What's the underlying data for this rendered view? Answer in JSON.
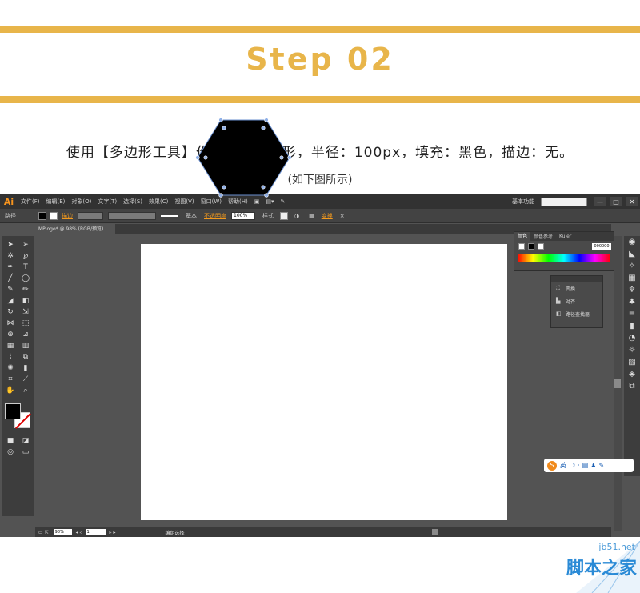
{
  "header": {
    "title": "Step 02"
  },
  "instruction": "使用【多边形工具】作一个正六边形，半径：100px，填充：黑色，描边：无。",
  "caption": "(如下图所示)",
  "illustrator": {
    "logo": "Ai",
    "menu": [
      "文件(F)",
      "编辑(E)",
      "对象(O)",
      "文字(T)",
      "选择(S)",
      "效果(C)",
      "视图(V)",
      "窗口(W)",
      "帮助(H)"
    ],
    "workspace": "基本功能",
    "window_buttons": [
      "—",
      "□",
      "✕"
    ],
    "control": {
      "object_type": "路径",
      "stroke_label": "描边",
      "stroke_profile": "基本",
      "opacity_label": "不透明度",
      "opacity_value": "100%",
      "style_label": "样式",
      "transform_label": "变换"
    },
    "document_tab": "MPlogo* @ 98% (RGB/预览)",
    "color_panel": {
      "tabs": [
        "颜色",
        "颜色参考",
        "Kuler"
      ],
      "hex_value": "000000"
    },
    "transform_panel": {
      "items": [
        {
          "icon": "transform-icon",
          "label": "变换"
        },
        {
          "icon": "align-icon",
          "label": "对齐"
        },
        {
          "icon": "pathfinder-icon",
          "label": "路径查找器"
        }
      ]
    },
    "ime": {
      "label": "英"
    },
    "status": {
      "zoom": "98%",
      "page": "1",
      "tool_text": "编组选择"
    },
    "shape": {
      "type": "hexagon",
      "fill": "#000000",
      "stroke": "none",
      "radius_px": 100
    }
  },
  "watermark": {
    "url": "jb51.net",
    "site": "脚本之家"
  },
  "colors": {
    "accent": "#e8b54a",
    "ai_orange": "#f39a1d"
  }
}
